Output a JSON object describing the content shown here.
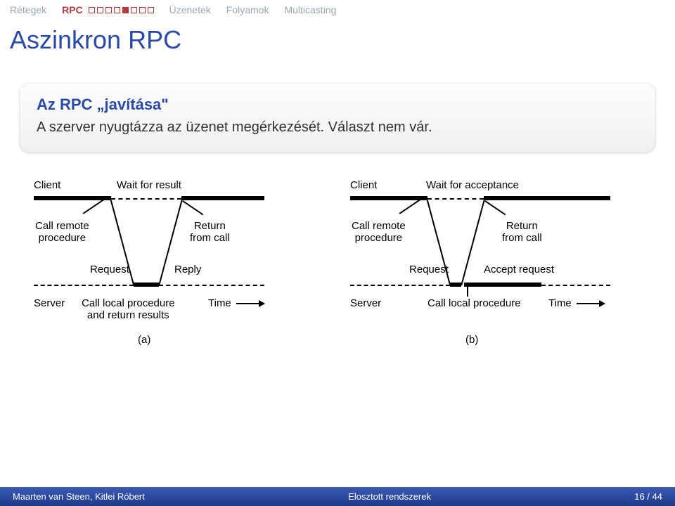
{
  "nav": {
    "tabs": [
      "Rétegek",
      "RPC",
      "Üzenetek",
      "Folyamok",
      "Multicasting"
    ]
  },
  "title": "Aszinkron RPC",
  "box": {
    "heading": "Az RPC „javítása\"",
    "body": "A szerver nyugtázza az üzenet megérkezését. Választ nem vár."
  },
  "diagram": {
    "left": {
      "client": "Client",
      "wait": "Wait for result",
      "call_remote_l1": "Call remote",
      "call_remote_l2": "procedure",
      "return_l1": "Return",
      "return_l2": "from call",
      "request": "Request",
      "reply": "Reply",
      "server": "Server",
      "call_local_l1": "Call local procedure",
      "call_local_l2": "and return results",
      "time": "Time",
      "caption": "(a)"
    },
    "right": {
      "client": "Client",
      "wait": "Wait for acceptance",
      "call_remote_l1": "Call remote",
      "call_remote_l2": "procedure",
      "return_l1": "Return",
      "return_l2": "from call",
      "request": "Request",
      "accept": "Accept request",
      "server": "Server",
      "call_local": "Call local procedure",
      "time": "Time",
      "caption": "(b)"
    }
  },
  "footer": {
    "authors": "Maarten van Steen, Kitlei Róbert",
    "center": "Elosztott rendszerek",
    "page": "16 / 44"
  }
}
